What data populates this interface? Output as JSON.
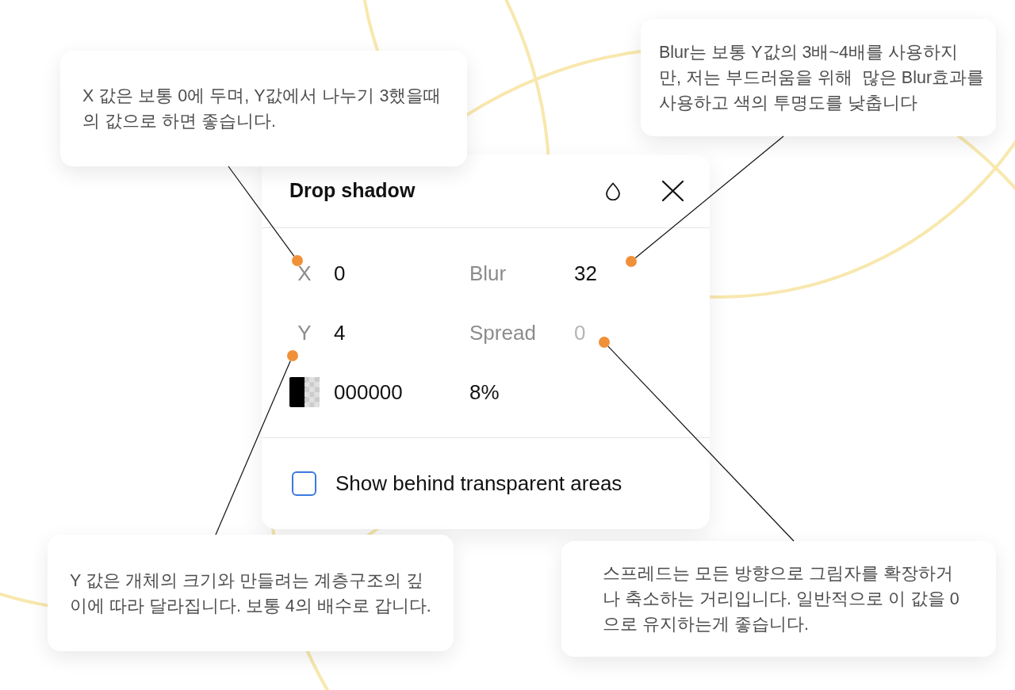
{
  "panel": {
    "title": "Drop shadow",
    "fields": [
      {
        "label": "X",
        "value": "0",
        "disabled": false
      },
      {
        "label": "Blur",
        "value": "32",
        "disabled": false
      },
      {
        "label": "Y",
        "value": "4",
        "disabled": false
      },
      {
        "label": "Spread",
        "value": "0",
        "disabled": true
      }
    ],
    "fill": {
      "hex": "000000",
      "opacity": "8%"
    },
    "option": {
      "label": "Show behind transparent areas",
      "checked": false
    }
  },
  "callouts": [
    {
      "lines": [
        "X 값은 보통 0에 두며, Y값에서 나누기 3했을때",
        "의 값으로 하면 좋습니다."
      ]
    },
    {
      "lines": [
        "Blur는 보통 Y값의 3배~4배를 사용하지",
        "만, 저는 부드러움을 위해  많은 Blur효과를",
        "사용하고 색의 투명도를 낮춥니다"
      ]
    },
    {
      "lines": [
        "Y 값은 개체의 크기와 만들려는 계층구조의 깊",
        "이에 따라 달라집니다. 보통 4의 배수로 갑니다."
      ]
    },
    {
      "lines": [
        "스프레드는 모든 방향으로 그림자를 확장하거",
        "나 축소하는 거리입니다. 일반적으로 이 값을 0",
        "으로 유지하는게 좋습니다."
      ]
    }
  ]
}
